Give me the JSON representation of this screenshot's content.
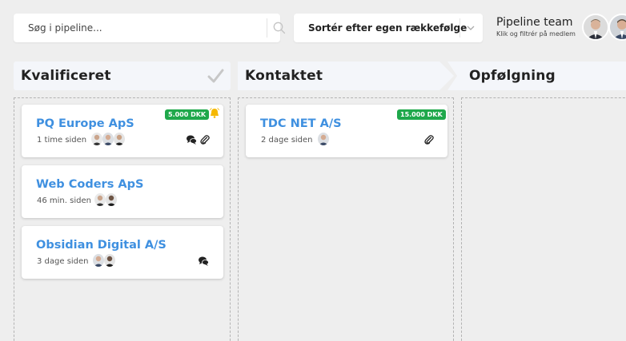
{
  "search": {
    "placeholder": "Søg i pipeline..."
  },
  "sort": {
    "label": "Sortér efter egen rækkefølge"
  },
  "team": {
    "title": "Pipeline team",
    "subtitle": "Klik og filtrér på medlem"
  },
  "columns": [
    {
      "name": "Kvalificeret"
    },
    {
      "name": "Kontaktet"
    },
    {
      "name": "Opfølgning"
    }
  ],
  "cards": [
    {
      "name": "PQ Europe ApS",
      "time": "1 time siden",
      "badge": "5.000 DKK"
    },
    {
      "name": "Web Coders ApS",
      "time": "46 min. siden"
    },
    {
      "name": "Obsidian Digital A/S",
      "time": "3 dage siden"
    },
    {
      "name": "TDC NET A/S",
      "time": "2 dage siden",
      "badge": "15.000 DKK"
    }
  ],
  "colors": {
    "accent": "#3f90e0",
    "badge": "#1fa84b",
    "bell": "#f5b800"
  }
}
